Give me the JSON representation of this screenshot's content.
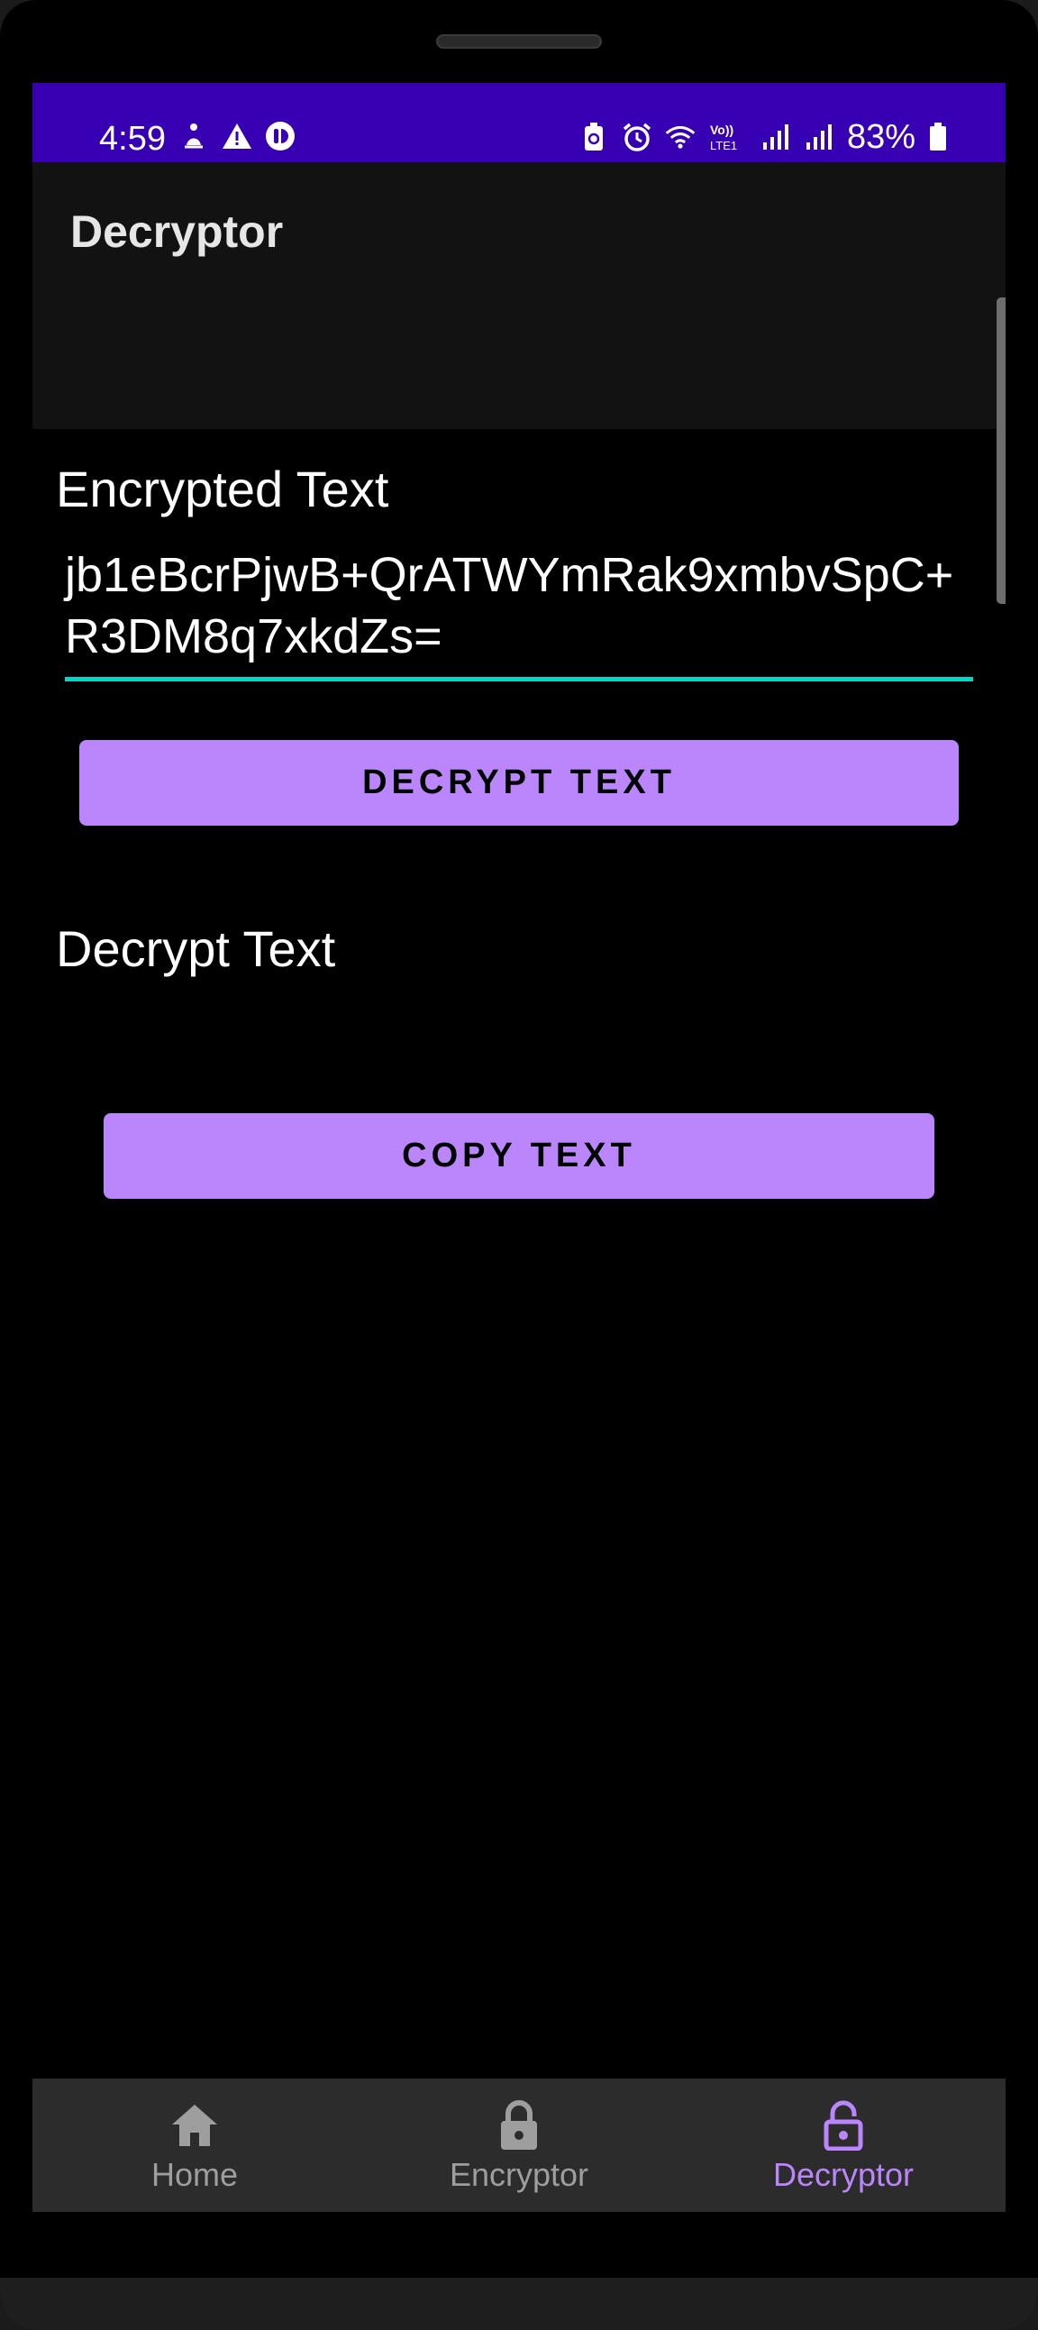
{
  "status_bar": {
    "time": "4:59",
    "battery": "83%",
    "left_icons": [
      "person-icon",
      "warning-icon",
      "app-notification-icon"
    ],
    "right_icons": [
      "battery-saver-icon",
      "alarm-icon",
      "wifi-icon",
      "volte-icon",
      "signal-icon",
      "signal-icon-2",
      "battery-icon"
    ],
    "volte_text": "Vo))\nLTE1"
  },
  "app_bar": {
    "title": "Decryptor"
  },
  "main": {
    "encrypted_label": "Encrypted Text",
    "encrypted_value": "jb1eBcrPjwB+QrATWYmRak9xmbvSpC+R3DM8q7xkdZs=",
    "decrypt_button": "DECRYPT TEXT",
    "decrypt_label": "Decrypt Text",
    "decrypt_value": "",
    "copy_button": "COPY TEXT"
  },
  "bottom_nav": {
    "items": [
      {
        "label": "Home",
        "icon": "home-icon",
        "active": false
      },
      {
        "label": "Encryptor",
        "icon": "lock-icon",
        "active": false
      },
      {
        "label": "Decryptor",
        "icon": "lock-open-icon",
        "active": true
      }
    ]
  },
  "colors": {
    "status_bar": "#3700b3",
    "app_bar": "#121212",
    "accent": "#bb86fc",
    "field_underline": "#03dac5",
    "nav_bg": "#2c2c2c",
    "nav_inactive": "#9e9e9e"
  }
}
